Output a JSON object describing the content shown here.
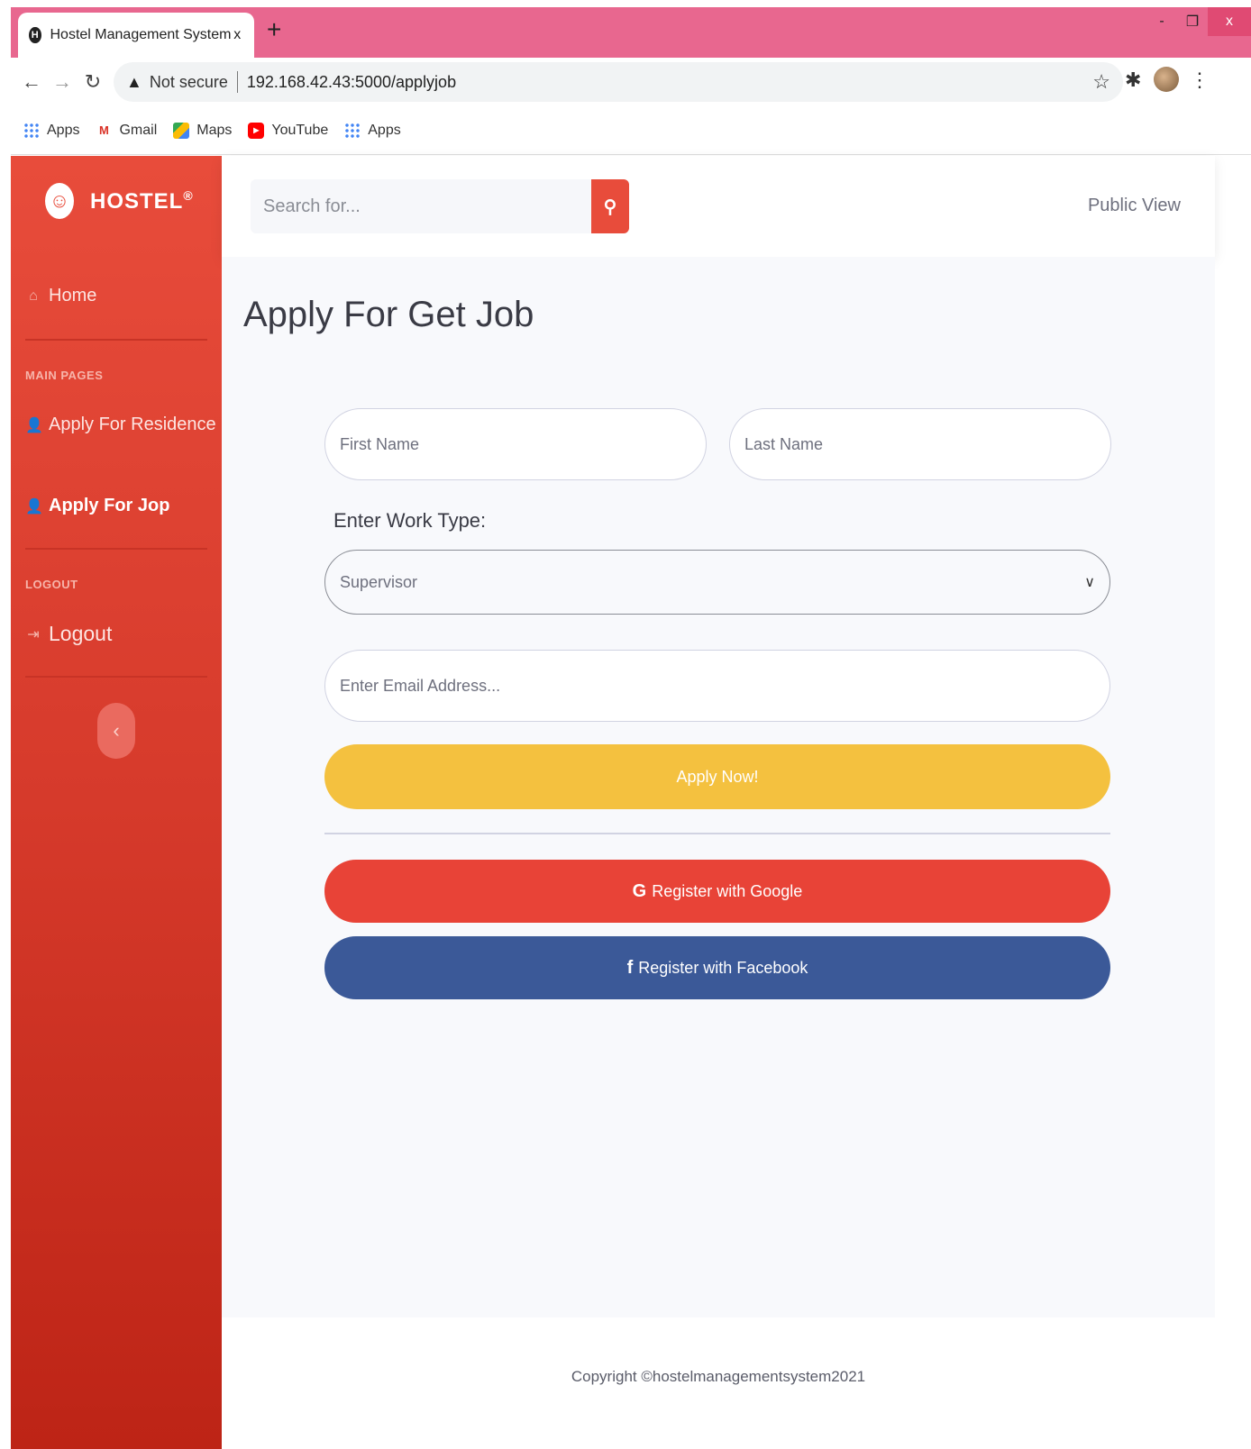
{
  "browser": {
    "tab_title": "Hostel Management System",
    "tab_favicon": "H",
    "tab_close": "x",
    "new_tab": "+",
    "not_secure": "Not secure",
    "url": "192.168.42.43:5000/applyjob",
    "window_buttons": {
      "minimize": "-",
      "restore": "❐",
      "close": "x"
    },
    "bookmarks": [
      {
        "label": "Apps",
        "icon": "apps-grid-icon"
      },
      {
        "label": "Gmail",
        "icon": "gmail-icon"
      },
      {
        "label": "Maps",
        "icon": "maps-icon"
      },
      {
        "label": "YouTube",
        "icon": "youtube-icon"
      },
      {
        "label": "Apps",
        "icon": "apps-grid-icon"
      }
    ]
  },
  "sidebar": {
    "brand": "HOSTEL",
    "brand_mark": "®",
    "home": "Home",
    "heading_main": "MAIN PAGES",
    "apply_residence": "Apply For Residence",
    "apply_job": "Apply For Jop",
    "heading_logout": "LOGOUT",
    "logout": "Logout",
    "toggle": "‹"
  },
  "topbar": {
    "search_placeholder": "Search for...",
    "public_view": "Public View"
  },
  "form": {
    "title": "Apply For Get Job",
    "first_name_placeholder": "First Name",
    "last_name_placeholder": "Last Name",
    "work_type_label": "Enter Work Type:",
    "work_type_value": "Supervisor",
    "email_placeholder": "Enter Email Address...",
    "apply_button": "Apply Now!",
    "google_button": "Register with Google",
    "facebook_button": "Register with Facebook"
  },
  "footer": {
    "copyright": "Copyright ©hostelmanagementsystem2021"
  },
  "colors": {
    "primary_red": "#e84c3b",
    "apply_yellow": "#f4c13f",
    "google_red": "#e84337",
    "facebook_blue": "#3b5998",
    "tabbar_pink": "#e8678f"
  }
}
